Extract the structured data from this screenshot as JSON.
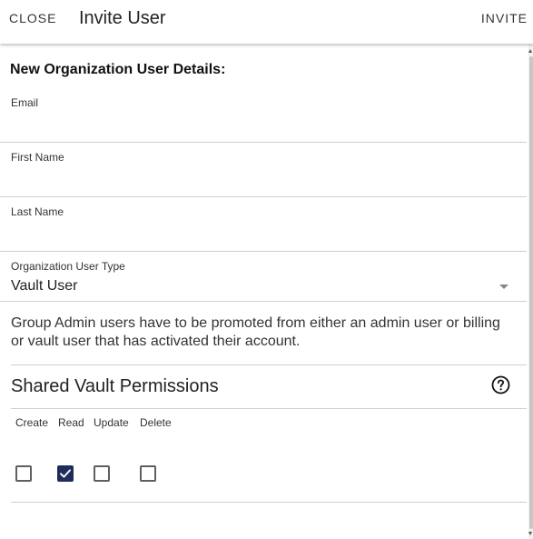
{
  "header": {
    "close_label": "CLOSE",
    "title": "Invite User",
    "invite_label": "INVITE"
  },
  "form": {
    "section_title": "New Organization User Details:",
    "email": {
      "label": "Email",
      "value": ""
    },
    "first_name": {
      "label": "First Name",
      "value": ""
    },
    "last_name": {
      "label": "Last Name",
      "value": ""
    },
    "user_type": {
      "label": "Organization User Type",
      "value": "Vault User"
    },
    "note": "Group Admin users have to be promoted from either an admin user or billing or vault user that has activated their account."
  },
  "permissions": {
    "title": "Shared Vault Permissions",
    "help_icon": "help-circle-icon",
    "columns": [
      {
        "label": "Create",
        "checked": false
      },
      {
        "label": "Read",
        "checked": true
      },
      {
        "label": "Update",
        "checked": false
      },
      {
        "label": "Delete",
        "checked": false
      }
    ]
  },
  "colors": {
    "checked_fill": "#1f2d5a",
    "divider": "#cfcfcf"
  }
}
